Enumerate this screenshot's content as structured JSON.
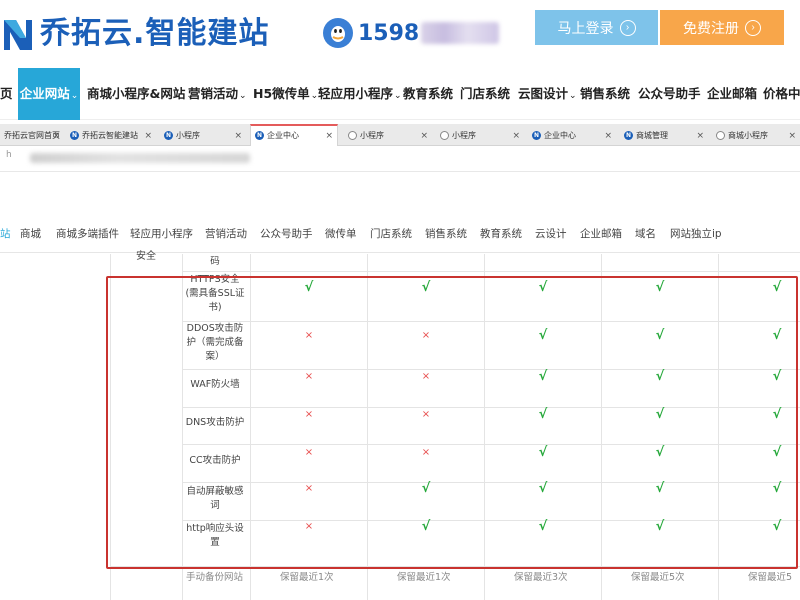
{
  "header": {
    "brand": "乔拓云.智能建站",
    "phone_visible": "1598",
    "login_label": "马上登录",
    "register_label": "免费注册"
  },
  "nav": {
    "items": [
      {
        "label": "页",
        "caret": ""
      },
      {
        "label": "企业网站",
        "caret": "⌄"
      },
      {
        "label": "商城小程序&网站",
        "caret": "⌄"
      },
      {
        "label": "营销活动",
        "caret": "⌄"
      },
      {
        "label": "H5微传单",
        "caret": "⌄"
      },
      {
        "label": "轻应用小程序",
        "caret": "⌄"
      },
      {
        "label": "教育系统",
        "caret": ""
      },
      {
        "label": "门店系统",
        "caret": ""
      },
      {
        "label": "云图设计",
        "caret": "⌄"
      },
      {
        "label": "销售系统",
        "caret": ""
      },
      {
        "label": "公众号助手",
        "caret": ""
      },
      {
        "label": "企业邮箱",
        "caret": ""
      },
      {
        "label": "价格中心",
        "caret": ""
      }
    ]
  },
  "browser_tabs": [
    {
      "label": "乔拓云官网首页",
      "icon": "globe"
    },
    {
      "label": "乔拓云智能建站",
      "icon": "brand"
    },
    {
      "label": "小程序",
      "icon": "brand"
    },
    {
      "label": "企业中心",
      "icon": "brand"
    },
    {
      "label": "小程序",
      "icon": "globe"
    },
    {
      "label": "小程序",
      "icon": "globe"
    },
    {
      "label": "企业中心",
      "icon": "brand"
    },
    {
      "label": "商城管理",
      "icon": "brand"
    },
    {
      "label": "商城小程序",
      "icon": "globe"
    }
  ],
  "address": {
    "prefix": "h"
  },
  "subnav": {
    "items": [
      "站",
      "商城",
      "商城多端插件",
      "轻应用小程序",
      "营销活动",
      "公众号助手",
      "微传单",
      "门店系统",
      "销售系统",
      "教育系统",
      "云设计",
      "企业邮箱",
      "域名",
      "网站独立ip"
    ]
  },
  "table": {
    "category": "安全",
    "partial_top_label": "码",
    "rows": [
      {
        "feature": [
          "HTTPS安全",
          "(需具备SSL证",
          "书)"
        ],
        "marks": [
          "yes",
          "yes",
          "yes",
          "yes",
          "yes"
        ]
      },
      {
        "feature": [
          "DDOS攻击防",
          "护（需完成备",
          "案）"
        ],
        "marks": [
          "no",
          "no",
          "yes",
          "yes",
          "yes"
        ]
      },
      {
        "feature": [
          "WAF防火墙"
        ],
        "marks": [
          "no",
          "no",
          "yes",
          "yes",
          "yes"
        ]
      },
      {
        "feature": [
          "DNS攻击防护"
        ],
        "marks": [
          "no",
          "no",
          "yes",
          "yes",
          "yes"
        ]
      },
      {
        "feature": [
          "CC攻击防护"
        ],
        "marks": [
          "no",
          "no",
          "yes",
          "yes",
          "yes"
        ]
      },
      {
        "feature": [
          "自动屏蔽敏感",
          "词"
        ],
        "marks": [
          "no",
          "yes",
          "yes",
          "yes",
          "yes"
        ]
      },
      {
        "feature": [
          "http响应头设",
          "置"
        ],
        "marks": [
          "no",
          "yes",
          "yes",
          "yes",
          "yes"
        ]
      }
    ],
    "mark_glyphs": {
      "yes": "√",
      "no": "×"
    },
    "partial_bottom": {
      "feature": "手动备份网站",
      "values": [
        "保留最近1次",
        "保留最近1次",
        "保留最近3次",
        "保留最近5次",
        "保留最近5"
      ]
    }
  },
  "colors": {
    "brand_blue": "#1b5fb8",
    "accent": "#27a7d8",
    "login_bg": "#7ec3ea",
    "register_bg": "#f8a64a",
    "highlight_box": "#c9332f",
    "check": "#25a83a",
    "cross": "#e74c4c"
  }
}
